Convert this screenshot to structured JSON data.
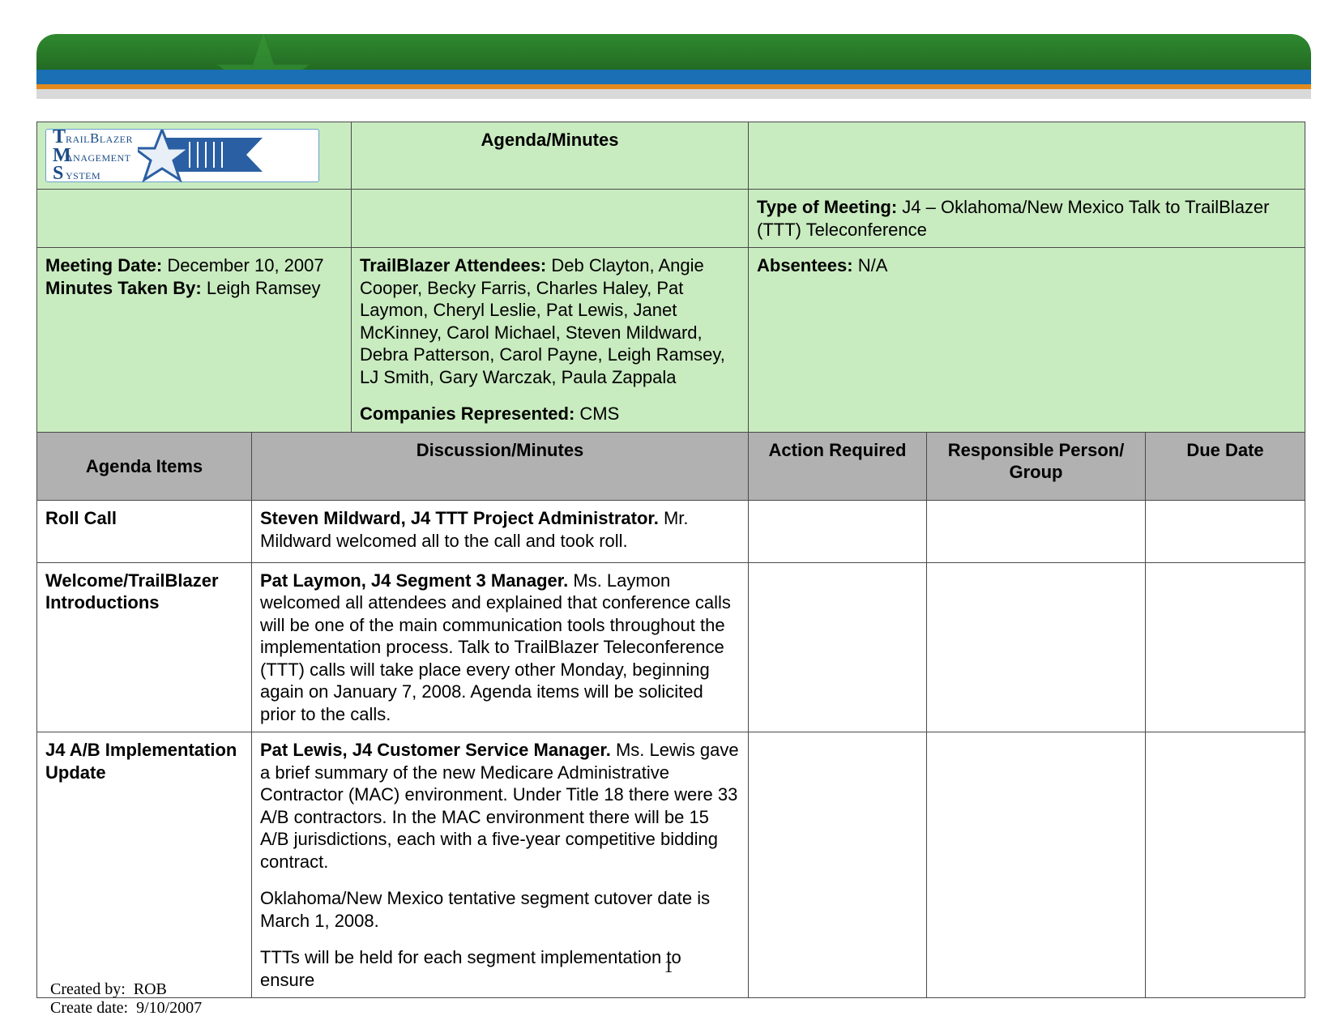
{
  "logo": {
    "line1_initial": "T",
    "line1_rest": "railBlazer",
    "line2_initial": "M",
    "line2_rest": "anagement",
    "line3_initial": "S",
    "line3_rest": "ystem"
  },
  "header": {
    "title": "Agenda/Minutes",
    "meeting_type_label": "Type of Meeting:",
    "meeting_type_value": "J4 – Oklahoma/New Mexico Talk to TrailBlazer (TTT) Teleconference",
    "meeting_date_label": "Meeting Date:",
    "meeting_date_value": "December 10, 2007",
    "minutes_by_label": "Minutes Taken By:",
    "minutes_by_value": "Leigh Ramsey",
    "attendees_label": "TrailBlazer Attendees:",
    "attendees_value": "Deb Clayton, Angie Cooper, Becky Farris, Charles Haley, Pat Laymon, Cheryl Leslie, Pat Lewis, Janet McKinney, Carol Michael, Steven Mildward, Debra Patterson, Carol Payne, Leigh Ramsey, LJ Smith, Gary Warczak, Paula Zappala",
    "companies_label": "Companies Represented:",
    "companies_value": "CMS",
    "absentees_label": "Absentees:",
    "absentees_value": "N/A"
  },
  "columns": {
    "agenda": "Agenda Items",
    "discussion": "Discussion/Minutes",
    "action": "Action Required",
    "responsible": "Responsible Person/ Group",
    "due": "Due Date"
  },
  "rows": [
    {
      "agenda": "Roll Call",
      "lead": "Steven Mildward, J4 TTT Project Administrator.",
      "para1": "Mr. Mildward welcomed all to the call and took roll.",
      "para2": "",
      "para3": ""
    },
    {
      "agenda": "Welcome/TrailBlazer Introductions",
      "lead": "Pat Laymon, J4 Segment 3 Manager.",
      "para1": "Ms. Laymon welcomed all attendees and explained that conference calls will be one of the main communication tools throughout the implementation process. Talk to TrailBlazer Teleconference (TTT) calls will take place every other Monday, beginning again on January 7, 2008. Agenda items will be solicited prior to the calls.",
      "para2": "",
      "para3": ""
    },
    {
      "agenda": "J4 A/B Implementation Update",
      "lead": "Pat Lewis, J4 Customer Service Manager.",
      "para1": "Ms. Lewis gave a brief summary of the new Medicare Administrative Contractor (MAC) environment. Under Title 18 there were 33 A/B contractors. In the MAC environment there will be 15 A/B jurisdictions, each with a five-year competitive bidding contract.",
      "para2": "Oklahoma/New Mexico tentative segment cutover date is March 1, 2008.",
      "para3": "TTTs will be held for each segment implementation to ensure"
    }
  ],
  "footer": {
    "page_number": "1",
    "created_by_label": "Created by:",
    "created_by_value": "ROB",
    "create_date_label": "Create date:",
    "create_date_value": "9/10/2007"
  }
}
